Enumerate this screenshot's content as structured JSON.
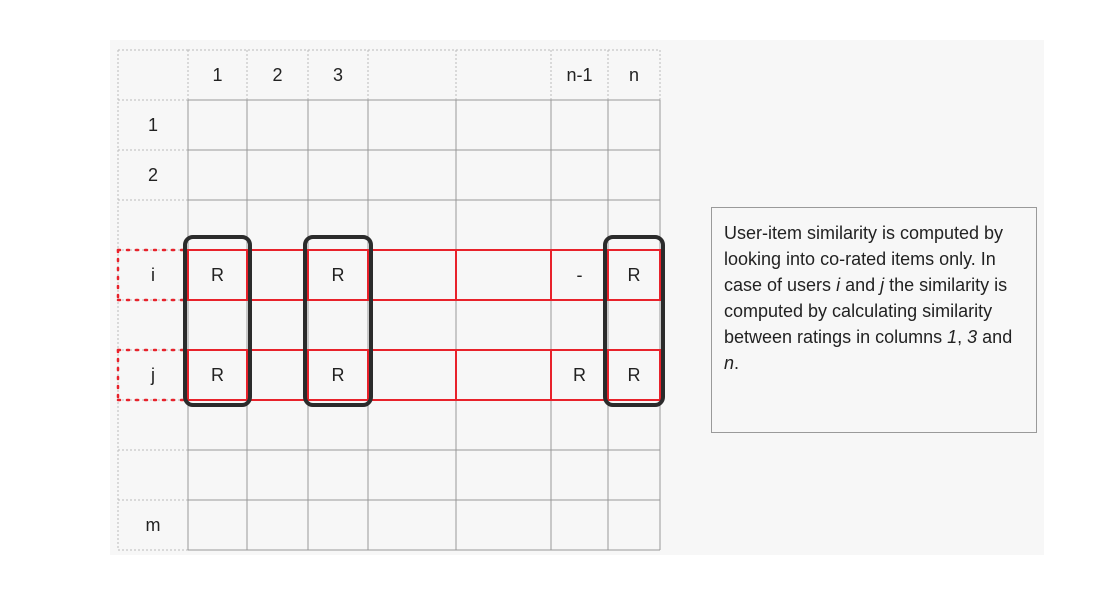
{
  "grid": {
    "column_headers": [
      "1",
      "2",
      "3",
      "",
      "",
      "n-1",
      "n"
    ],
    "row_headers": [
      "1",
      "2",
      "",
      "i",
      "",
      "j",
      "",
      "",
      "m"
    ],
    "rows": [
      {
        "row_index": 3,
        "label": "i",
        "cells": [
          "R",
          "",
          "R",
          "",
          "",
          "-",
          "R"
        ]
      },
      {
        "row_index": 5,
        "label": "j",
        "cells": [
          "R",
          "",
          "R",
          "",
          "",
          "R",
          "R"
        ]
      }
    ],
    "corated_columns": [
      0,
      2,
      6
    ]
  },
  "colors": {
    "grid_line": "#999999",
    "dotted_line": "#bbbbbb",
    "user_row_highlight": "#e8222b",
    "corated_column_highlight": "#2b2b2b"
  },
  "note": {
    "text_1": "User-item similarity is computed by looking into co-rated items only. In case of users ",
    "user_i": "i",
    "text_2": " and ",
    "user_j": "j",
    "text_3": " the similarity is computed by calculating similarity between ratings in columns ",
    "col_a": "1",
    "text_4": ", ",
    "col_b": "3",
    "text_5": " and ",
    "col_c": "n",
    "text_6": "."
  }
}
